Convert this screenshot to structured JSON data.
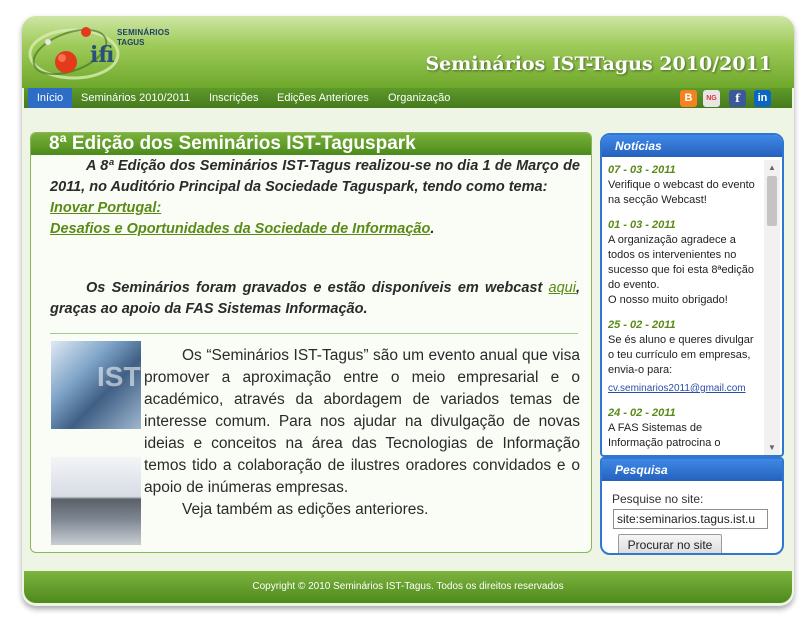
{
  "header": {
    "logo_line1": "SEMINÁRIOS",
    "logo_line2": "TAGUS",
    "logo_mark": "ifi",
    "site_title": "Seminários IST-Tagus 2010/2011"
  },
  "nav": {
    "items": [
      {
        "label": "Início",
        "active": true
      },
      {
        "label": "Seminários 2010/2011"
      },
      {
        "label": "Inscrições"
      },
      {
        "label": "Edições Anteriores"
      },
      {
        "label": "Organização"
      }
    ],
    "social": [
      {
        "icon": "blogger-icon",
        "glyph": "B",
        "color": "#f58220"
      },
      {
        "icon": "ning-icon",
        "glyph": "NG",
        "color": "#e6e6e6"
      },
      {
        "icon": "facebook-icon",
        "glyph": "f",
        "color": "#3b5998"
      },
      {
        "icon": "linkedin-icon",
        "glyph": "in",
        "color": "#0a66c2"
      }
    ]
  },
  "main": {
    "title": "8ª Edição dos Seminários IST-Taguspark",
    "intro": {
      "text": "A 8ª Edição dos Seminários IST-Tagus realizou-se no dia 1 de Março de 2011, no Auditório Principal da Sociedade Taguspark, tendo como tema:",
      "link1": "Inovar Portugal:",
      "link2": "Desafios e Oportunidades da Sociedade de Informação",
      "link2_suffix": "."
    },
    "webcast": {
      "before": "Os Seminários foram gravados e estão disponíveis em webcast ",
      "link": "aqui",
      "after": ", graças ao apoio da FAS Sistemas Informação."
    },
    "description": "Os “Seminários IST-Tagus” são um evento anual que visa promover a aproximação entre o meio empresarial e o académico, através da abordagem de variados temas de interesse comum. Para nos ajudar na divulgação de novas ideias e conceitos na área das Tecnologias de Informação temos tido a colaboração de ilustres oradores convidados e o apoio de inúmeras empresas.",
    "see_also": "Veja também as edições anteriores.",
    "image1_text": "IST"
  },
  "news": {
    "title": "Notícias",
    "items": [
      {
        "date": "07 - 03 - 2011",
        "text": "Verifique o webcast do evento na secção Webcast!"
      },
      {
        "date": "01 - 03 - 2011",
        "text": "A organização agradece a todos os intervenientes no sucesso que foi esta 8ªedição do evento.",
        "text2": "O nosso muito obrigado!"
      },
      {
        "date": "25 - 02 - 2011",
        "text": "Se és aluno e queres divulgar o teu currículo em empresas, envia-o para:",
        "link": "cv.seminarios2011@gmail.com"
      },
      {
        "date": "24 - 02 - 2011",
        "text": "A FAS Sistemas de Informação patrocina o"
      }
    ]
  },
  "search": {
    "title": "Pesquisa",
    "label": "Pesquise no site:",
    "value": "site:seminarios.tagus.ist.u",
    "button": "Procurar no site"
  },
  "footer": {
    "copyright": "Copyright © 2010 Seminários IST-Tagus. Todos os direitos reservados"
  }
}
